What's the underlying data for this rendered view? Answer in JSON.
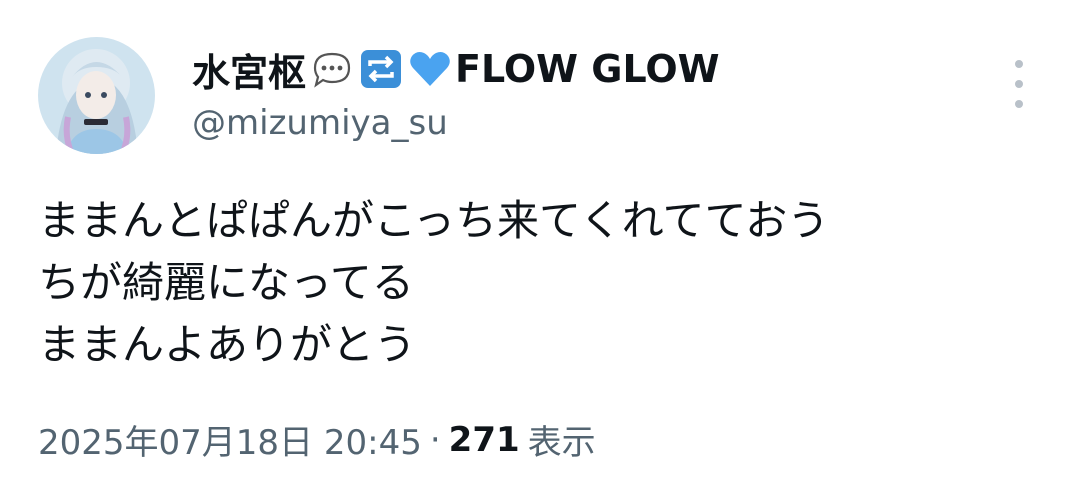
{
  "author": {
    "display_name": "水宮枢",
    "name_suffix": "FLOW GLOW",
    "name_emojis": [
      "speech-bubble-icon",
      "repeat-icon",
      "blue-heart-icon"
    ],
    "handle": "@mizumiya_su"
  },
  "tweet": {
    "lines": [
      "ままんとぱぱんがこっち来てくれてておう",
      "ちが綺麗になってる",
      "ままんよありがとう"
    ]
  },
  "meta": {
    "timestamp": "2025年07月18日 20:45",
    "separator": "·",
    "views_count": "271",
    "views_label": "表示"
  },
  "colors": {
    "text": "#0f1419",
    "secondary": "#536471",
    "heart": "#4aa3f0",
    "repeat_bg": "#3b8fd8"
  }
}
